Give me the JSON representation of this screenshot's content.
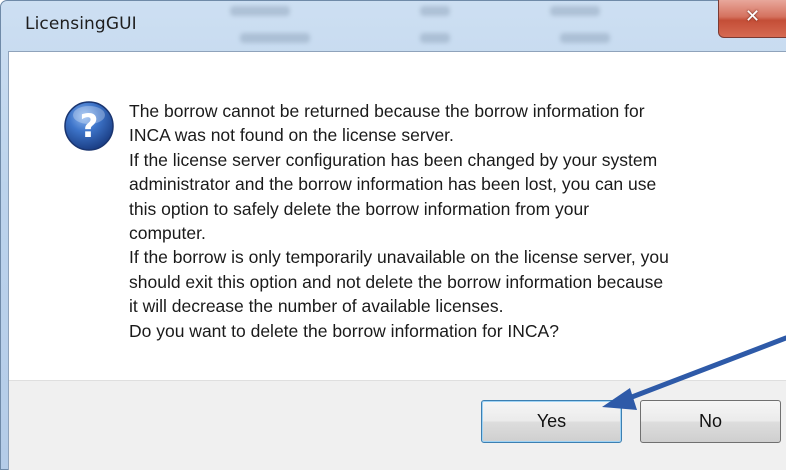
{
  "window": {
    "title": "LicensingGUI",
    "close_glyph": "✕"
  },
  "dialog": {
    "icon": "question-icon",
    "message_lines": [
      "The borrow cannot be returned because the borrow information for",
      "INCA was not found on the license server.",
      "If the license server configuration has been changed by your system",
      "administrator and the borrow information has been lost, you can use",
      "this option to safely delete the borrow information from your",
      "computer.",
      "If the borrow is only temporarily unavailable on the license server, you",
      "should exit this option and not delete the borrow information because",
      "it will decrease the number of available licenses.",
      "Do you want to delete the borrow information for INCA?"
    ]
  },
  "buttons": {
    "yes_label": "Yes",
    "no_label": "No"
  },
  "annotation": {
    "arrow_color": "#2e5aa8",
    "points_to": "yes-button"
  },
  "colors": {
    "title_bar": "#bcd3ec",
    "close_button": "#c44e37",
    "button_area": "#f0f0f0",
    "icon_blue": "#2a5db0"
  }
}
